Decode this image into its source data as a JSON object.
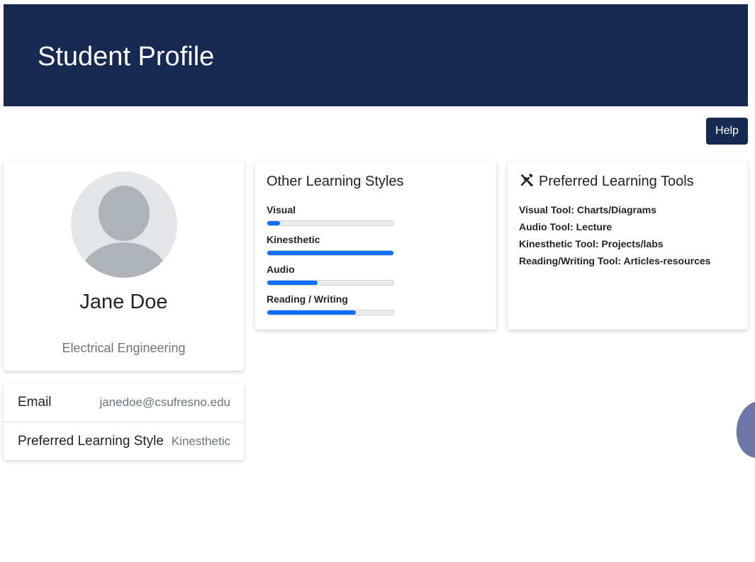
{
  "header": {
    "title": "Student Profile"
  },
  "help": {
    "label": "Help"
  },
  "profile": {
    "name": "Jane Doe",
    "major": "Electrical Engineering"
  },
  "info": {
    "rows": [
      {
        "label": "Email",
        "value": "janedoe@csufresno.edu"
      },
      {
        "label": "Preferred Learning Style",
        "value": "Kinesthetic"
      }
    ]
  },
  "learning_styles": {
    "title": "Other Learning Styles",
    "items": [
      {
        "label": "Visual",
        "percent": 10
      },
      {
        "label": "Kinesthetic",
        "percent": 100
      },
      {
        "label": "Audio",
        "percent": 40
      },
      {
        "label": "Reading / Writing",
        "percent": 70
      }
    ]
  },
  "tools": {
    "title": "Preferred Learning Tools",
    "icon": "tools-icon",
    "items": [
      "Visual Tool: Charts/Diagrams",
      "Audio Tool: Lecture",
      "Kinesthetic Tool: Projects/labs",
      "Reading/Writing Tool: Articles-resources"
    ]
  },
  "colors": {
    "banner": "#152951",
    "progress": "#0d6efd",
    "muted_text": "#6c757d"
  }
}
